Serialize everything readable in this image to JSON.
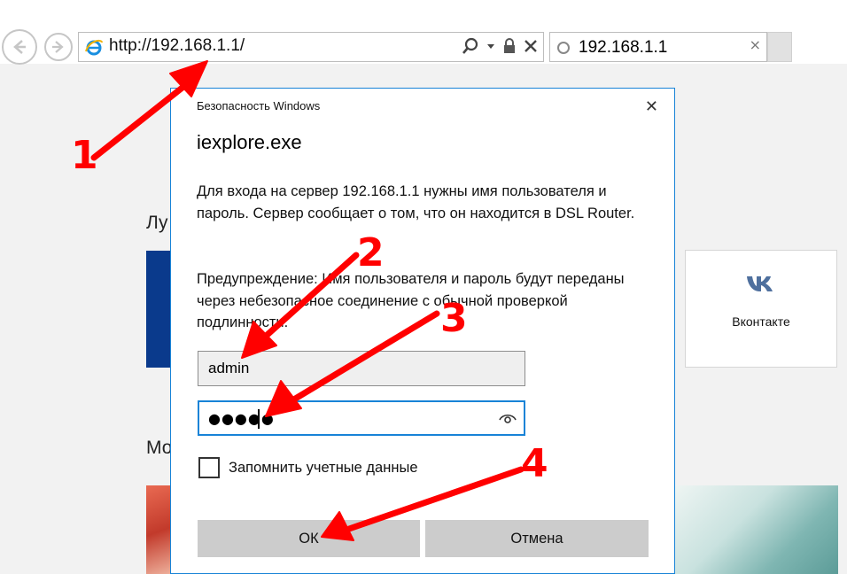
{
  "browser": {
    "address_url": "http://192.168.1.1/",
    "tab_title": "192.168.1.1",
    "tab_close": "×"
  },
  "page": {
    "heading_1": "Лу",
    "heading_2": "Мо",
    "vk_tile_label": "Вконтакте"
  },
  "dialog": {
    "caption": "Безопасность Windows",
    "close_glyph": "✕",
    "app_name": "iexplore.exe",
    "message_1": "Для входа на сервер 192.168.1.1 нужны имя пользователя и пароль. Сервер сообщает о том, что он находится в DSL Router.",
    "message_2": "Предупреждение: Имя пользователя и пароль будут переданы через небезопасное соединение с обычной проверкой подлинности.",
    "username_value": "admin",
    "password_mask": "●●●●●",
    "remember_label": "Запомнить учетные данные",
    "ok_label": "ОК",
    "cancel_label": "Отмена"
  },
  "annotations": {
    "step_1": "1",
    "step_2": "2",
    "step_3": "3",
    "step_4": "4",
    "arrow_color": "#ff0000"
  }
}
